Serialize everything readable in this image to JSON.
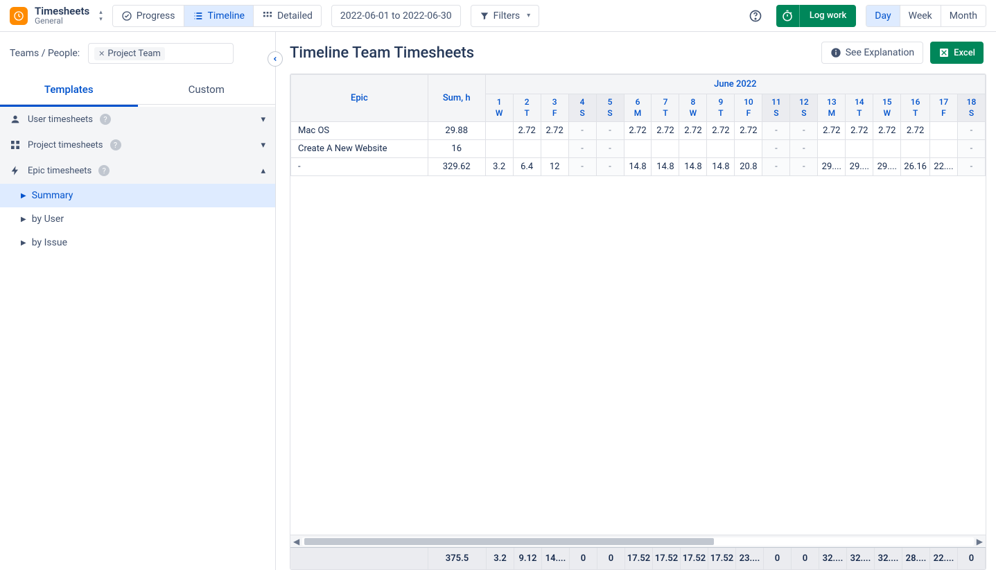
{
  "brand": {
    "title": "Timesheets",
    "subtitle": "General"
  },
  "views": {
    "progress": "Progress",
    "timeline": "Timeline",
    "detailed": "Detailed"
  },
  "dateRange": "2022-06-01 to 2022-06-30",
  "filters": {
    "label": "Filters"
  },
  "logWork": "Log work",
  "timescale": {
    "day": "Day",
    "week": "Week",
    "month": "Month"
  },
  "sidebar": {
    "filterLabel": "Teams / People:",
    "tag": "Project Team",
    "tabs": {
      "templates": "Templates",
      "custom": "Custom"
    },
    "groups": {
      "user": "User timesheets",
      "project": "Project timesheets",
      "epic": "Epic timesheets"
    },
    "epicItems": {
      "summary": "Summary",
      "byUser": "by User",
      "byIssue": "by Issue"
    }
  },
  "page": {
    "title": "Timeline Team Timesheets",
    "explain": "See Explanation",
    "excel": "Excel"
  },
  "table": {
    "epicHeader": "Epic",
    "sumHeader": "Sum, h",
    "monthHeader": "June 2022",
    "days": [
      {
        "n": "1",
        "d": "W",
        "w": false
      },
      {
        "n": "2",
        "d": "T",
        "w": false
      },
      {
        "n": "3",
        "d": "F",
        "w": false
      },
      {
        "n": "4",
        "d": "S",
        "w": true
      },
      {
        "n": "5",
        "d": "S",
        "w": true
      },
      {
        "n": "6",
        "d": "M",
        "w": false
      },
      {
        "n": "7",
        "d": "T",
        "w": false
      },
      {
        "n": "8",
        "d": "W",
        "w": false
      },
      {
        "n": "9",
        "d": "T",
        "w": false
      },
      {
        "n": "10",
        "d": "F",
        "w": false
      },
      {
        "n": "11",
        "d": "S",
        "w": true
      },
      {
        "n": "12",
        "d": "S",
        "w": true
      },
      {
        "n": "13",
        "d": "M",
        "w": false
      },
      {
        "n": "14",
        "d": "T",
        "w": false
      },
      {
        "n": "15",
        "d": "W",
        "w": false
      },
      {
        "n": "16",
        "d": "T",
        "w": false
      },
      {
        "n": "17",
        "d": "F",
        "w": false
      },
      {
        "n": "18",
        "d": "S",
        "w": true
      }
    ],
    "rows": [
      {
        "name": "Mac OS",
        "sum": "29.88",
        "cells": [
          "",
          "2.72",
          "2.72",
          "-",
          "-",
          "2.72",
          "2.72",
          "2.72",
          "2.72",
          "2.72",
          "-",
          "-",
          "2.72",
          "2.72",
          "2.72",
          "2.72",
          "",
          "-"
        ]
      },
      {
        "name": "Create A New Website",
        "sum": "16",
        "cells": [
          "",
          "",
          "",
          "-",
          "-",
          "",
          "",
          "",
          "",
          "",
          "-",
          "-",
          "",
          "",
          "",
          "",
          "",
          "-"
        ]
      },
      {
        "name": "-",
        "sum": "329.62",
        "cells": [
          "3.2",
          "6.4",
          "12",
          "-",
          "-",
          "14.8",
          "14.8",
          "14.8",
          "14.8",
          "20.8",
          "-",
          "-",
          "29....",
          "29....",
          "29....",
          "26.16",
          "22....",
          "-"
        ]
      }
    ],
    "totals": {
      "sum": "375.5",
      "cells": [
        "3.2",
        "9.12",
        "14....",
        "0",
        "0",
        "17.52",
        "17.52",
        "17.52",
        "17.52",
        "23....",
        "0",
        "0",
        "32....",
        "32....",
        "32....",
        "28....",
        "22....",
        "0"
      ]
    }
  }
}
